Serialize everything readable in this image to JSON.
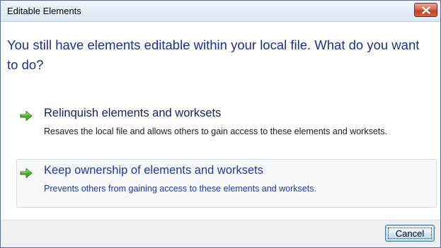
{
  "window": {
    "title": "Editable Elements"
  },
  "icons": {
    "close": "close-icon",
    "option_arrow": "green-arrow-icon"
  },
  "colors": {
    "question_text": "#1e3287",
    "arrow_green": "#3a9c1f",
    "close_red": "#c14528"
  },
  "dialog": {
    "question": "You still have elements editable within your local file. What do you want to do?",
    "options": [
      {
        "title": "Relinquish elements and worksets",
        "description": "Resaves the local file and allows others to gain access to these elements and worksets."
      },
      {
        "title": "Keep ownership of elements and worksets",
        "description": "Prevents others from gaining access to these elements and worksets."
      }
    ]
  },
  "footer": {
    "cancel_label": "Cancel"
  }
}
